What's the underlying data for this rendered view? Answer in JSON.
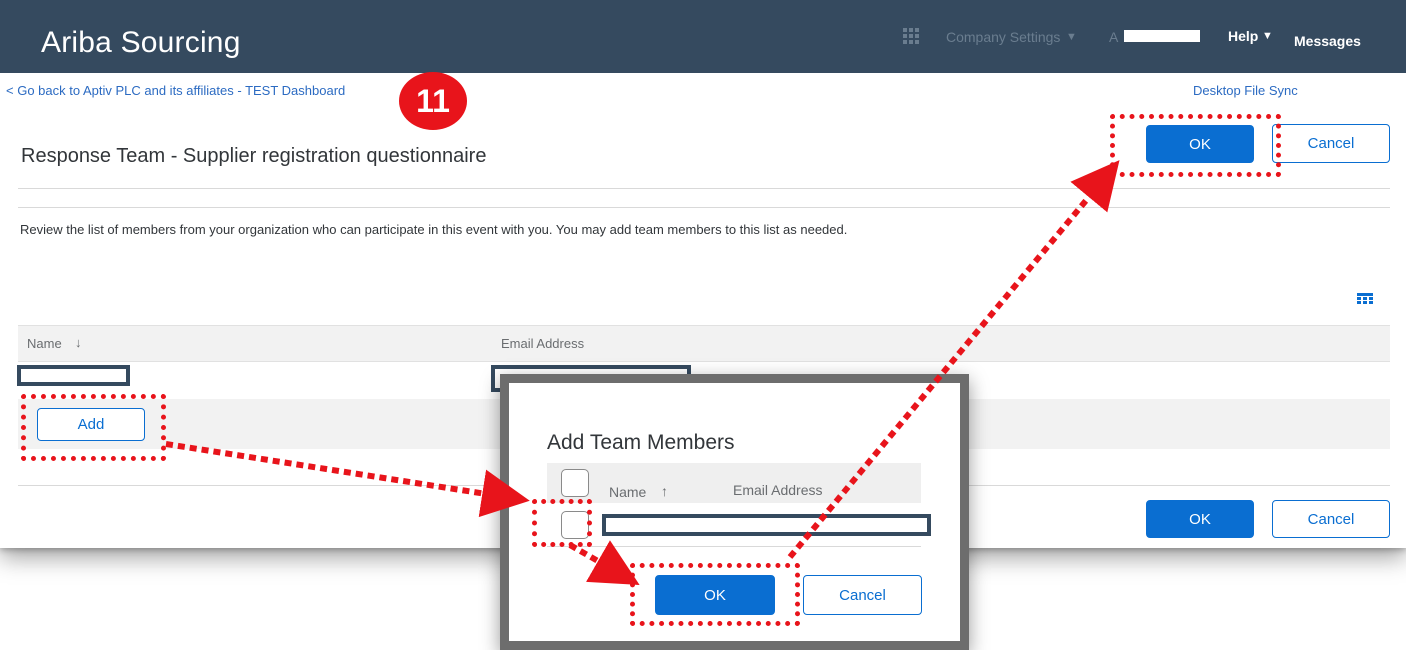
{
  "header": {
    "brand": "Ariba Sourcing",
    "company_settings": "Company Settings",
    "user_initial": "A",
    "help": "Help",
    "messages": "Messages"
  },
  "nav": {
    "back_link": "< Go back to Aptiv PLC and its affiliates - TEST Dashboard",
    "desktop_file_sync": "Desktop File Sync"
  },
  "step_badge": "11",
  "page": {
    "title": "Response Team - Supplier registration questionnaire",
    "description": "Review the list of members from your organization who can participate in this event with you. You may add team members to this list as needed."
  },
  "buttons": {
    "ok": "OK",
    "cancel": "Cancel",
    "add": "Add"
  },
  "table": {
    "columns": [
      "Name",
      "Email Address"
    ],
    "sort_indicator": "↓"
  },
  "dialog": {
    "title": "Add Team Members",
    "columns": [
      "Name",
      "Email Address"
    ],
    "sort_indicator": "↑",
    "ok": "OK",
    "cancel": "Cancel"
  },
  "colors": {
    "topbar": "#354a5f",
    "primary": "#0a6ed1",
    "highlight": "#e8141b",
    "link": "#2c6bc2"
  }
}
